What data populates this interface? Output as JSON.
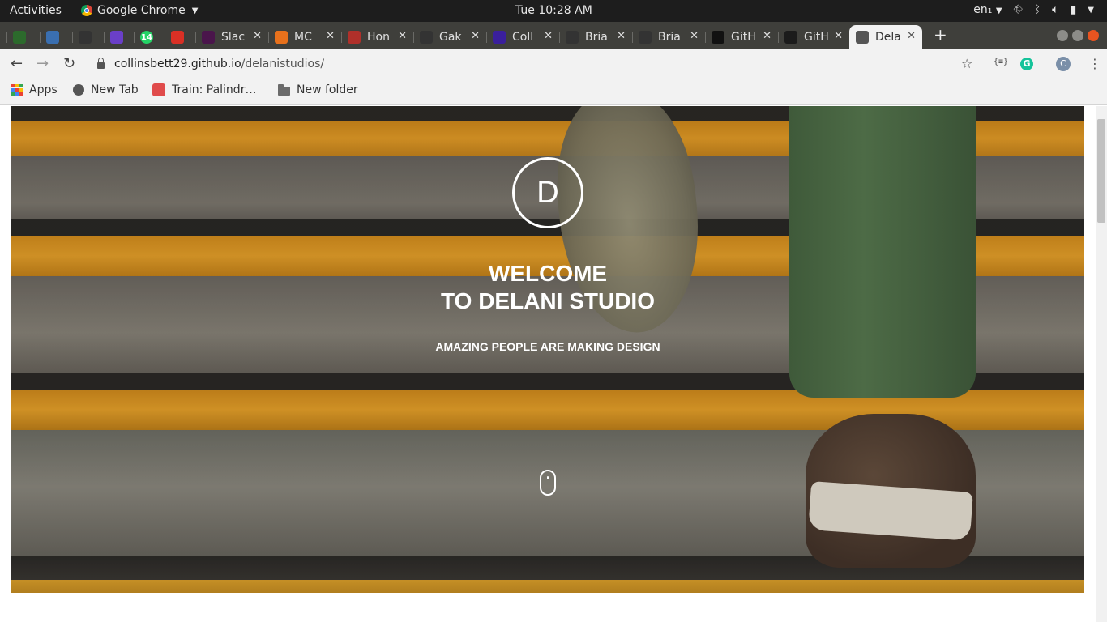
{
  "topbar": {
    "activities": "Activities",
    "app_name": "Google Chrome",
    "clock": "Tue 10:28 AM",
    "input_method": "en₁"
  },
  "tabs": [
    {
      "title": "",
      "favicon": "jira-icon",
      "color": "#2c6a2c"
    },
    {
      "title": "",
      "favicon": "chart-icon",
      "color": "#3a6fb0"
    },
    {
      "title": "",
      "favicon": "github-icon",
      "color": "#333333"
    },
    {
      "title": "",
      "favicon": "graduation-cap-icon",
      "color": "#6a3fc8"
    },
    {
      "title": "",
      "favicon": "whatsapp-icon",
      "color": "#25d366",
      "badge": "14"
    },
    {
      "title": "",
      "favicon": "gmail-icon",
      "color": "#d93025"
    },
    {
      "title": "Slac",
      "favicon": "slack-icon",
      "color": "#4a154b"
    },
    {
      "title": "MC",
      "favicon": "mc-icon",
      "color": "#e8711c"
    },
    {
      "title": "Hon",
      "favicon": "hon-icon",
      "color": "#b0302a"
    },
    {
      "title": "Gak",
      "favicon": "github-icon",
      "color": "#333333"
    },
    {
      "title": "Coll",
      "favicon": "codepen-c-icon",
      "color": "#3a1f9c"
    },
    {
      "title": "Bria",
      "favicon": "github-icon",
      "color": "#333333"
    },
    {
      "title": "Bria",
      "favicon": "github-icon",
      "color": "#333333"
    },
    {
      "title": "GitH",
      "favicon": "github-icon",
      "color": "#111111"
    },
    {
      "title": "GitH",
      "favicon": "angular-icon",
      "color": "#1b1b1b"
    },
    {
      "title": "Dela",
      "favicon": "globe-icon",
      "color": "#555555",
      "active": true
    }
  ],
  "omnibox": {
    "host": "collinsbett29.github.io",
    "path": "/delanistudios/"
  },
  "toolbar": {
    "json_ext": "{≡}",
    "avatar_letter": "C"
  },
  "bookmarks": [
    {
      "label": "Apps",
      "icon": "apps-grid-icon"
    },
    {
      "label": "New Tab",
      "icon": "globe-icon"
    },
    {
      "label": "Train: Palindr…",
      "icon": "train-icon"
    },
    {
      "label": "New folder",
      "icon": "folder-icon"
    }
  ],
  "hero": {
    "logo_letter": "D",
    "title_line1": "WELCOME",
    "title_line2": "TO DELANI STUDIO",
    "subtitle": "AMAZING PEOPLE ARE MAKING DESIGN"
  }
}
